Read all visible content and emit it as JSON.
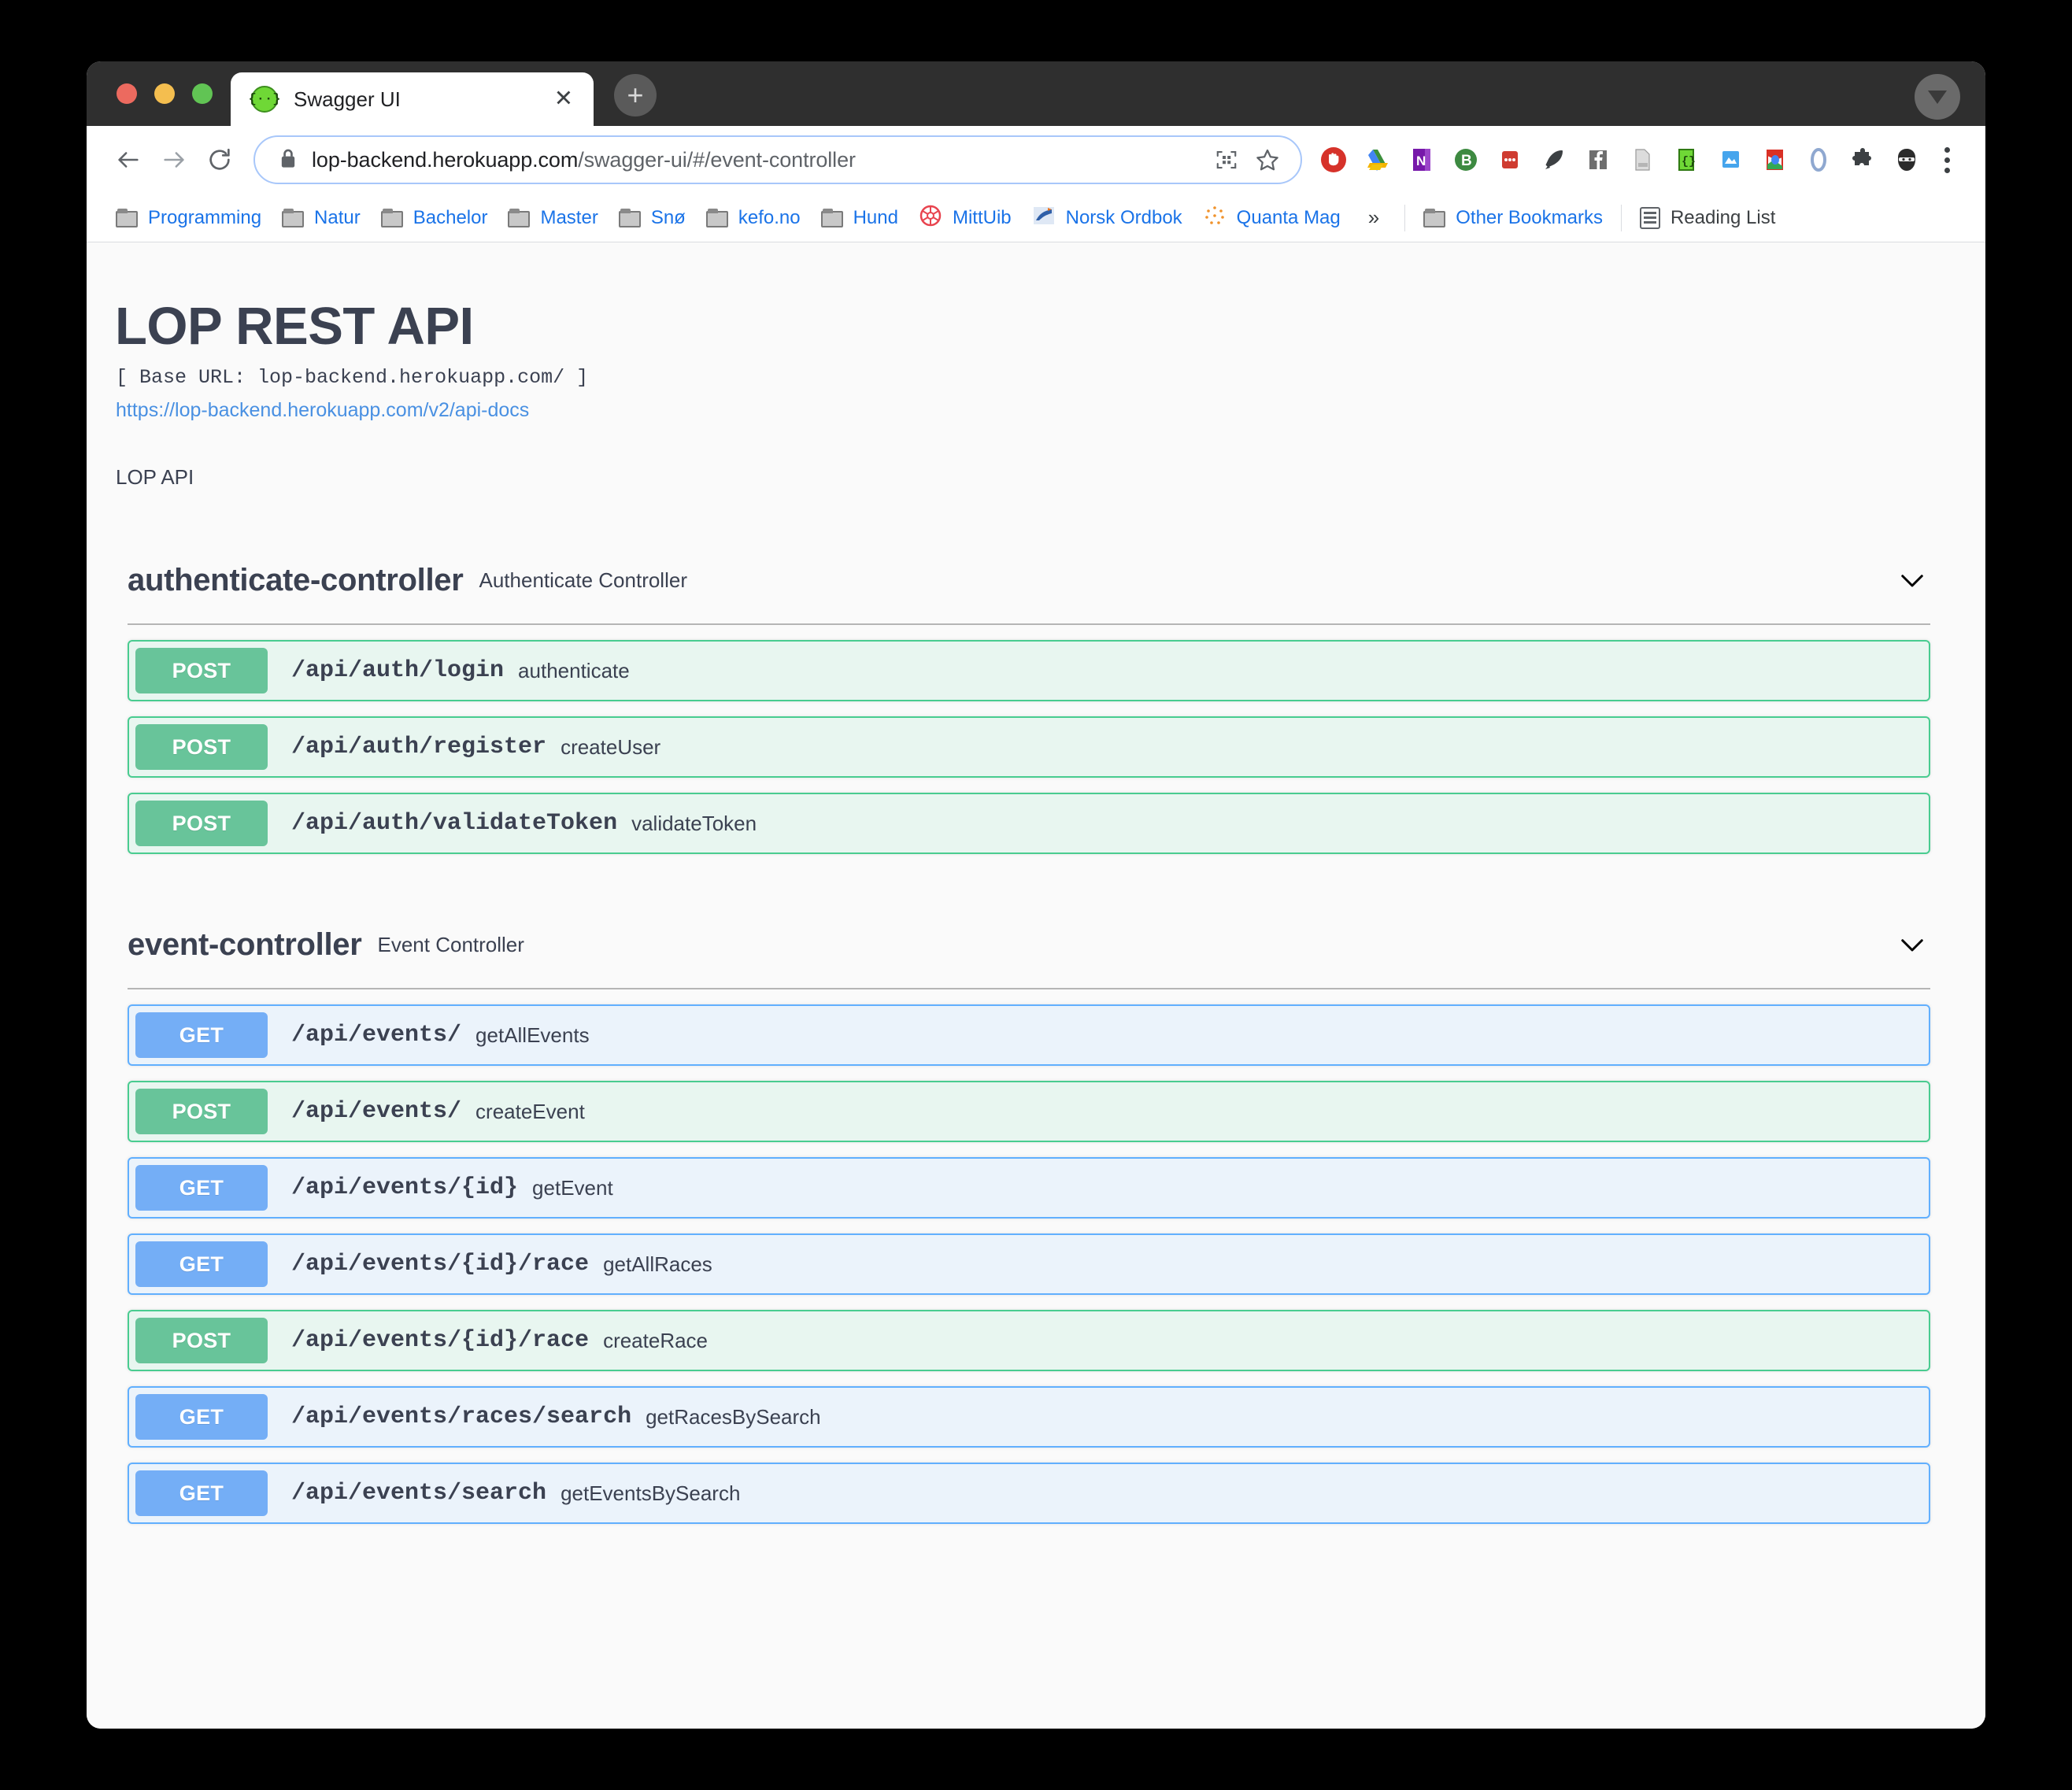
{
  "window": {
    "traffic_lights": [
      "close",
      "minimize",
      "maximize"
    ],
    "avatar_icon": "caret-down-avatar-icon"
  },
  "tab": {
    "title": "Swagger UI",
    "favicon_glyph": "{··}",
    "close_glyph": "✕",
    "new_tab_glyph": "+"
  },
  "toolbar": {
    "back_icon": "back-arrow-icon",
    "forward_icon": "forward-arrow-icon",
    "reload_icon": "reload-icon",
    "lock_icon": "lock-icon",
    "url_secure": "lop-backend.herokuapp.com",
    "url_path": "/swagger-ui/#/event-controller",
    "url_full": "lop-backend.herokuapp.com/swagger-ui/#/event-controller",
    "qr_icon": "qr-code-icon",
    "bookmark_icon": "star-icon",
    "menu_icon": "kebab-menu-icon",
    "extensions": [
      {
        "name": "adblock-extension-icon",
        "color": "#d6322a"
      },
      {
        "name": "google-drive-extension-icon",
        "color": "#1a73e8"
      },
      {
        "name": "onenote-extension-icon",
        "color": "#7719aa"
      },
      {
        "name": "bitwarden-extension-icon",
        "color": "#3d8a41"
      },
      {
        "name": "pocket-extension-icon",
        "color": "#cf3c31"
      },
      {
        "name": "rocket-extension-icon",
        "color": "#3c4043"
      },
      {
        "name": "facebook-extension-icon",
        "color": "#6e6e6e"
      },
      {
        "name": "document-extension-icon",
        "color": "#bdbdbd"
      },
      {
        "name": "json-viewer-extension-icon",
        "color": "#6fd836"
      },
      {
        "name": "onedrive-extension-icon",
        "color": "#46a5ed"
      },
      {
        "name": "google-arts-extension-icon",
        "color": "#d93025"
      },
      {
        "name": "zotero-extension-icon",
        "color": "#8fa8d0"
      },
      {
        "name": "puzzle-extensions-icon",
        "color": "#3c4043"
      },
      {
        "name": "profile-avatar-icon",
        "color": "#3c4043"
      }
    ]
  },
  "bookmarks": {
    "items": [
      {
        "label": "Programming",
        "icon": "folder-icon"
      },
      {
        "label": "Natur",
        "icon": "folder-icon"
      },
      {
        "label": "Bachelor",
        "icon": "folder-icon"
      },
      {
        "label": "Master",
        "icon": "folder-icon"
      },
      {
        "label": "Snø",
        "icon": "folder-icon"
      },
      {
        "label": "kefo.no",
        "icon": "folder-icon"
      },
      {
        "label": "Hund",
        "icon": "folder-icon"
      },
      {
        "label": "MittUib",
        "icon": "mittuib-favicon"
      },
      {
        "label": "Norsk Ordbok",
        "icon": "norsk-ordbok-favicon"
      },
      {
        "label": "Quanta Mag",
        "icon": "quanta-mag-favicon"
      }
    ],
    "overflow_glyph": "»",
    "other_bookmarks": "Other Bookmarks",
    "reading_list": "Reading List"
  },
  "swagger": {
    "title": "LOP REST API",
    "base_url_line": "[ Base URL: lop-backend.herokuapp.com/ ]",
    "api_docs_link": "https://lop-backend.herokuapp.com/v2/api-docs",
    "description": "LOP API",
    "tags": [
      {
        "name": "authenticate-controller",
        "description": "Authenticate Controller",
        "collapse_icon": "chevron-down-icon",
        "operations": [
          {
            "method": "POST",
            "method_class": "post",
            "path": "/api/auth/login",
            "summary": "authenticate"
          },
          {
            "method": "POST",
            "method_class": "post",
            "path": "/api/auth/register",
            "summary": "createUser"
          },
          {
            "method": "POST",
            "method_class": "post",
            "path": "/api/auth/validateToken",
            "summary": "validateToken"
          }
        ]
      },
      {
        "name": "event-controller",
        "description": "Event Controller",
        "collapse_icon": "chevron-down-icon",
        "operations": [
          {
            "method": "GET",
            "method_class": "get",
            "path": "/api/events/",
            "summary": "getAllEvents"
          },
          {
            "method": "POST",
            "method_class": "post",
            "path": "/api/events/",
            "summary": "createEvent"
          },
          {
            "method": "GET",
            "method_class": "get",
            "path": "/api/events/{id}",
            "summary": "getEvent"
          },
          {
            "method": "GET",
            "method_class": "get",
            "path": "/api/events/{id}/race",
            "summary": "getAllRaces"
          },
          {
            "method": "POST",
            "method_class": "post",
            "path": "/api/events/{id}/race",
            "summary": "createRace"
          },
          {
            "method": "GET",
            "method_class": "get",
            "path": "/api/events/races/search",
            "summary": "getRacesBySearch"
          },
          {
            "method": "GET",
            "method_class": "get",
            "path": "/api/events/search",
            "summary": "getEventsBySearch"
          }
        ]
      }
    ]
  },
  "colors": {
    "get_badge": "#74aef6",
    "post_badge": "#68c49a",
    "get_row_bg": "#ebf3fb",
    "post_row_bg": "#e8f6f0",
    "get_border": "#61affe",
    "post_border": "#49cc90",
    "heading": "#3b4151",
    "link": "#4990e2",
    "page_bg": "#fafafa"
  }
}
